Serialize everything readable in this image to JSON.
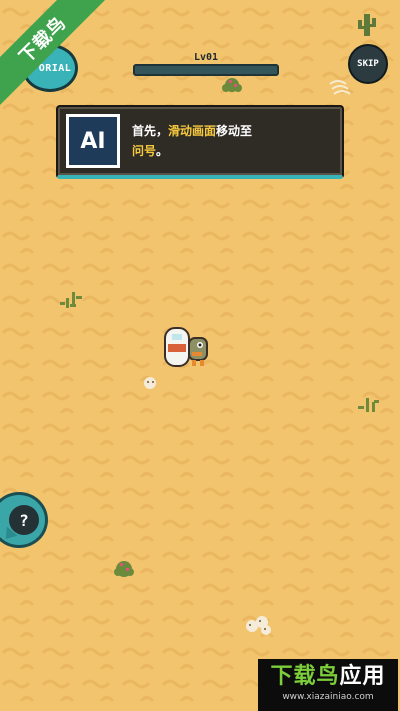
{
  "hud": {
    "tutorial_label": "ORIAL",
    "level_label": "Lv01",
    "xp_progress": 0,
    "skip_label": "SKIP"
  },
  "dialog": {
    "portrait_label": "AI",
    "text_part1": "首先，",
    "text_highlight1": "滑动画面",
    "text_part2": "移动至",
    "text_highlight2": "问号",
    "text_part3": "。"
  },
  "help_button": {
    "label": "?"
  },
  "watermark": {
    "ribbon_text": "下载鸟",
    "title_green": "下载鸟",
    "title_white": "应用",
    "url": "www.xiazainiao.com"
  },
  "colors": {
    "sand": "#f2c46d",
    "accent": "#3ab3b8",
    "highlight": "#f6c83d",
    "dialog_bg": "#2f2b25"
  },
  "icons": {
    "cactus": "cactus-icon",
    "bush": "desert-bush-icon",
    "skull": "skull-icon",
    "player": "player-character"
  }
}
